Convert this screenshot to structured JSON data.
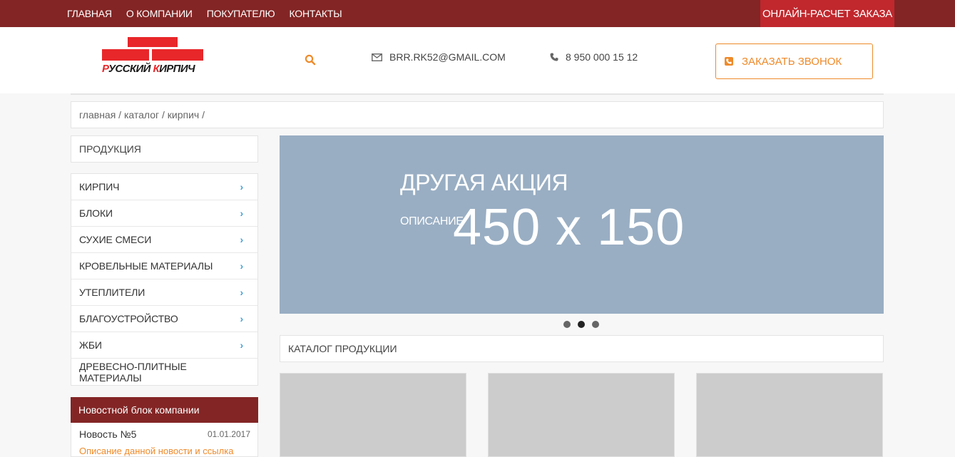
{
  "topnav": {
    "items": [
      "ГЛАВНАЯ",
      "О КОМПАНИИ",
      "ПОКУПАТЕЛЮ",
      "КОНТАКТЫ"
    ],
    "order_button": "ОНЛАЙН-РАСЧЕТ ЗАКАЗА"
  },
  "header": {
    "logo": {
      "part1_red": "Р",
      "part1": "УССКИЙ ",
      "part2_red": "К",
      "part2": "ИРПИЧ"
    },
    "email": "BRR.RK52@GMAIL.COM",
    "phone": "8 950 000 15 12",
    "callback_button": "ЗАКАЗАТЬ ЗВОНОК",
    "icons": [
      "search-icon",
      "envelope-icon",
      "phone-icon",
      "phone-square-icon"
    ]
  },
  "breadcrumb": "главная / каталог / кирпич /",
  "sidebar": {
    "title": "ПРОДУКЦИЯ",
    "items": [
      {
        "label": "КИРПИЧ",
        "has_arrow": true
      },
      {
        "label": "БЛОКИ",
        "has_arrow": true
      },
      {
        "label": "СУХИЕ СМЕСИ",
        "has_arrow": true
      },
      {
        "label": "КРОВЕЛЬНЫЕ МАТЕРИАЛЫ",
        "has_arrow": true
      },
      {
        "label": "УТЕПЛИТЕЛИ",
        "has_arrow": true
      },
      {
        "label": "БЛАГОУСТРОЙСТВО",
        "has_arrow": true
      },
      {
        "label": "ЖБИ",
        "has_arrow": true
      },
      {
        "label": "ДРЕВЕСНО-ПЛИТНЫЕ МАТЕРИАЛЫ",
        "has_arrow": false
      }
    ],
    "arrow_glyph": "›"
  },
  "news": {
    "title": "Новостной блок компании",
    "item_title": "Новость №5",
    "item_date": "01.01.2017",
    "item_desc": "Описание данной новости и ссылка"
  },
  "banner": {
    "title": "ДРУГАЯ АКЦИЯ",
    "description": "ОПИСАНИЕ",
    "placeholder": "450 x 150"
  },
  "slider": {
    "count": 3,
    "active": 2
  },
  "catalog": {
    "title": "КАТАЛОГ ПРОДУКЦИИ",
    "card_count": 3
  },
  "colors": {
    "topbar": "#832525",
    "accent_red": "#c0282d",
    "brick_red": "#e8272a",
    "orange": "#ef8a2a",
    "chevron_blue": "#3fa0d6",
    "banner_bg": "#99aec3"
  }
}
